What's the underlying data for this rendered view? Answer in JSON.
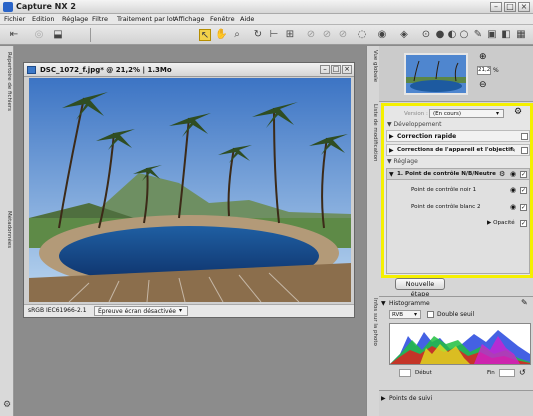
{
  "window": {
    "title": "Capture NX 2"
  },
  "menu": [
    "Fichier",
    "Edition",
    "Réglage",
    "Filtre",
    "Traitement par lot",
    "Affichage",
    "Fenêtre",
    "Aide"
  ],
  "left_tabs": {
    "top": "Répertoire de fichiers",
    "bottom": "Métadonnées"
  },
  "image_window": {
    "title": "DSC_1072_f.jpg* @ 21,2% | 1.3Mo",
    "color_profile": "sRGB IEC61966-2.1",
    "proof_dropdown": "Épreuve écran désactivée"
  },
  "right_tabs": {
    "navigator": "Vue globale",
    "edit_list": "Liste de modification",
    "photo_info": "Infos sur la photo"
  },
  "navigator": {
    "zoom_value": "21,2",
    "zoom_unit": "%"
  },
  "edit_list": {
    "version_label": "Version :",
    "version_value": "(En cours)",
    "development_label": "Développement",
    "quick_fix": "Correction rapide",
    "camera_lens": "Corrections de l'appareil et l'objectif",
    "adjustments_label": "Réglage",
    "step_title": "1. Point de contrôle N/B/Neutre",
    "black_point": "Point de contrôle noir 1",
    "white_point": "Point de contrôle blanc 2",
    "opacity": "Opacité"
  },
  "new_step_button": "Nouvelle étape",
  "histogram": {
    "title": "Histogramme",
    "channel": "RVB",
    "double_threshold": "Double seuil",
    "start_label": "Début",
    "end_label": "Fin"
  },
  "follow_points": "Points de suivi",
  "colors": {
    "highlight_border": "#f5f000",
    "title_blue": "#2a64c8"
  }
}
